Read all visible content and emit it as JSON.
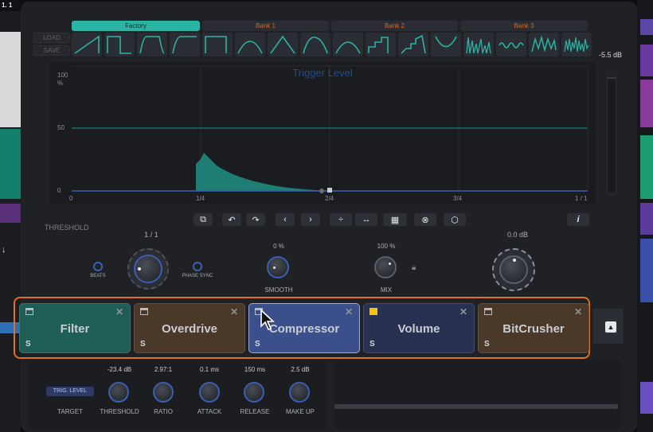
{
  "host": {
    "title_fragment": "1. 1"
  },
  "side_buttons": {
    "load": "LOAD",
    "save": "SAVE"
  },
  "banks": [
    {
      "label": "Factory",
      "color": "#2bb3a3"
    },
    {
      "label": "Bank 1",
      "color": "#d2692a"
    },
    {
      "label": "Bank 2",
      "color": "#d2692a"
    },
    {
      "label": "Bank 3",
      "color": "#d2692a"
    }
  ],
  "shape_icons": [
    "ramp-up-icon",
    "square-icon",
    "trapezoid-icon",
    "s-curve-icon",
    "hold-icon",
    "sine-icon",
    "triangle-icon",
    "hump-icon",
    "arch-icon",
    "steps-icon",
    "steps-down-icon",
    "v-shape-icon",
    "spikes-icon",
    "wave-icon",
    "zigzag-icon",
    "noise-icon"
  ],
  "graph": {
    "title": "Trigger Level",
    "y_ticks": [
      "100",
      "%",
      "50",
      "0"
    ],
    "x_ticks": [
      "0",
      "1/4",
      "2/4",
      "3/4",
      "1 / 1"
    ],
    "accent": "#2bb3a3"
  },
  "meter": {
    "value": "-5.5 dB"
  },
  "threshold_label": "THRESHOLD",
  "toolbar_icons": [
    "copy-icon",
    "undo-icon",
    "redo-icon",
    "prev-icon",
    "next-icon",
    "flip-vertical-icon",
    "flip-horizontal-icon",
    "shape-select-icon",
    "clear-icon",
    "random-icon"
  ],
  "info": "i",
  "rate": {
    "value": "1 / 1",
    "beats": "BEATS",
    "phase_sync": "PHASE SYNC"
  },
  "smooth": {
    "value": "0 %",
    "label": "SMOOTH"
  },
  "mix": {
    "value": "100 %",
    "label": "MIX"
  },
  "output": {
    "value": "0.0 dB"
  },
  "fx_slots": [
    {
      "name": "Filter",
      "s": "S",
      "close": "✕",
      "bg": "#1f5e55"
    },
    {
      "name": "Overdrive",
      "s": "S",
      "close": "✕",
      "bg": "#4a3828"
    },
    {
      "name": "Compressor",
      "s": "S",
      "close": "✕",
      "bg": "#3b4f8a"
    },
    {
      "name": "Volume",
      "s": "S",
      "close": "✕",
      "bg": "#283152"
    },
    {
      "name": "BitCrusher",
      "s": "S",
      "close": "✕",
      "bg": "#4a3828"
    }
  ],
  "bottom": {
    "target_badge": "TRIG. LEVEL",
    "target_label": "TARGET",
    "controls": [
      {
        "value": "-23.4 dB",
        "label": "THRESHOLD"
      },
      {
        "value": "2.97:1",
        "label": "RATIO"
      },
      {
        "value": "0.1 ms",
        "label": "ATTACK"
      },
      {
        "value": "150 ms",
        "label": "RELEASE"
      },
      {
        "value": "2.5 dB",
        "label": "MAKE UP"
      }
    ]
  }
}
